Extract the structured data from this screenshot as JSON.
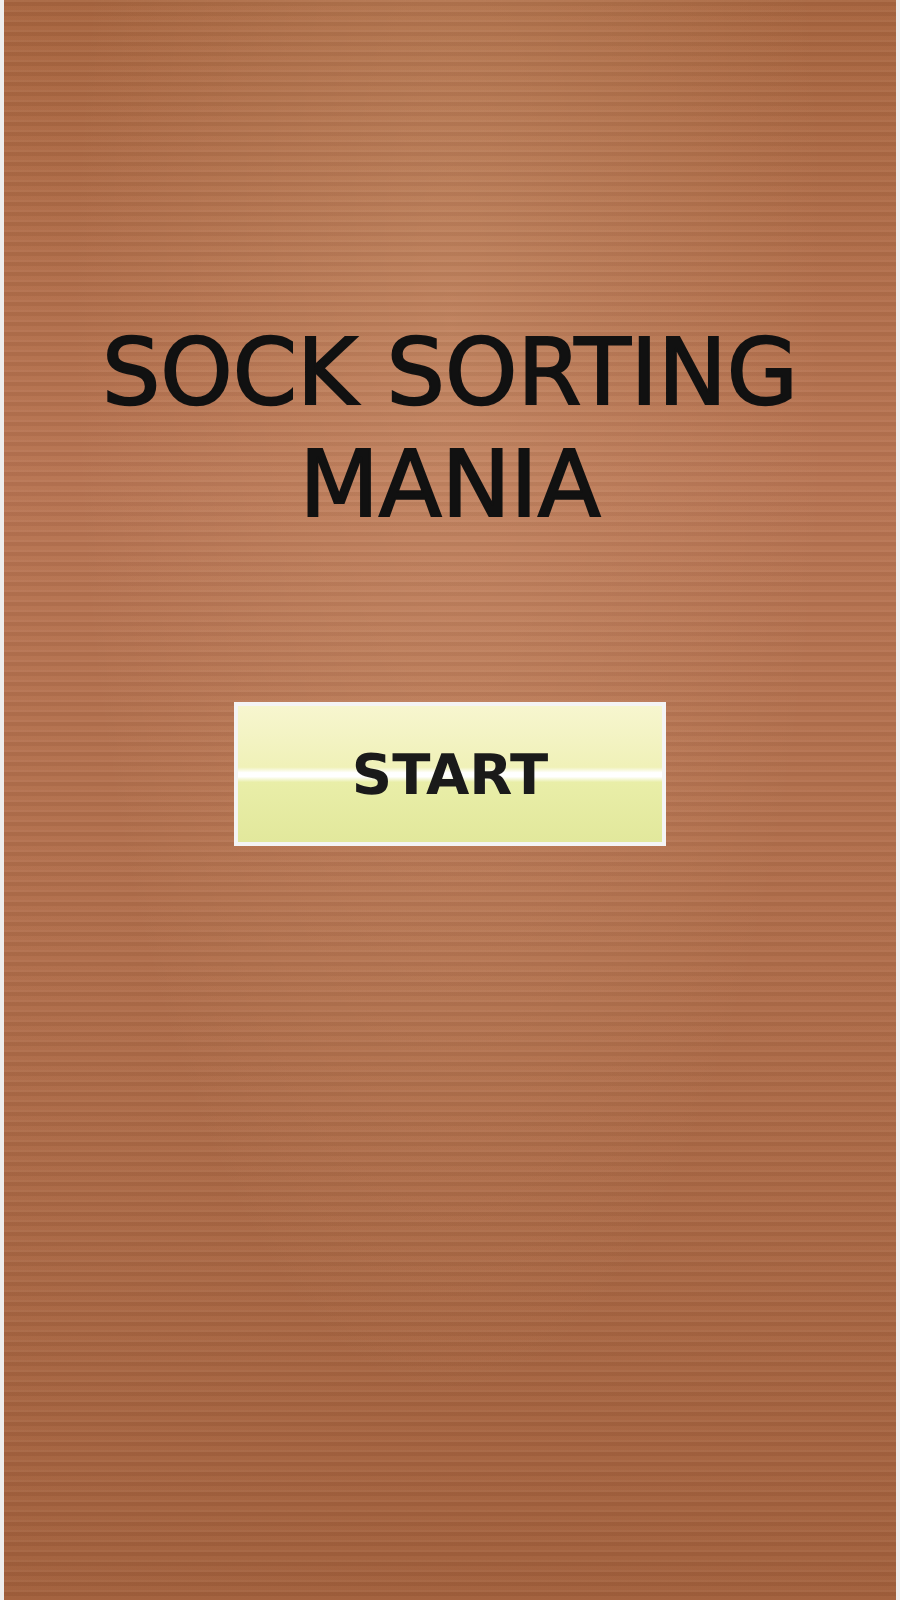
{
  "title": "SOCK SORTING MANIA",
  "start_button": {
    "label": "START"
  }
}
